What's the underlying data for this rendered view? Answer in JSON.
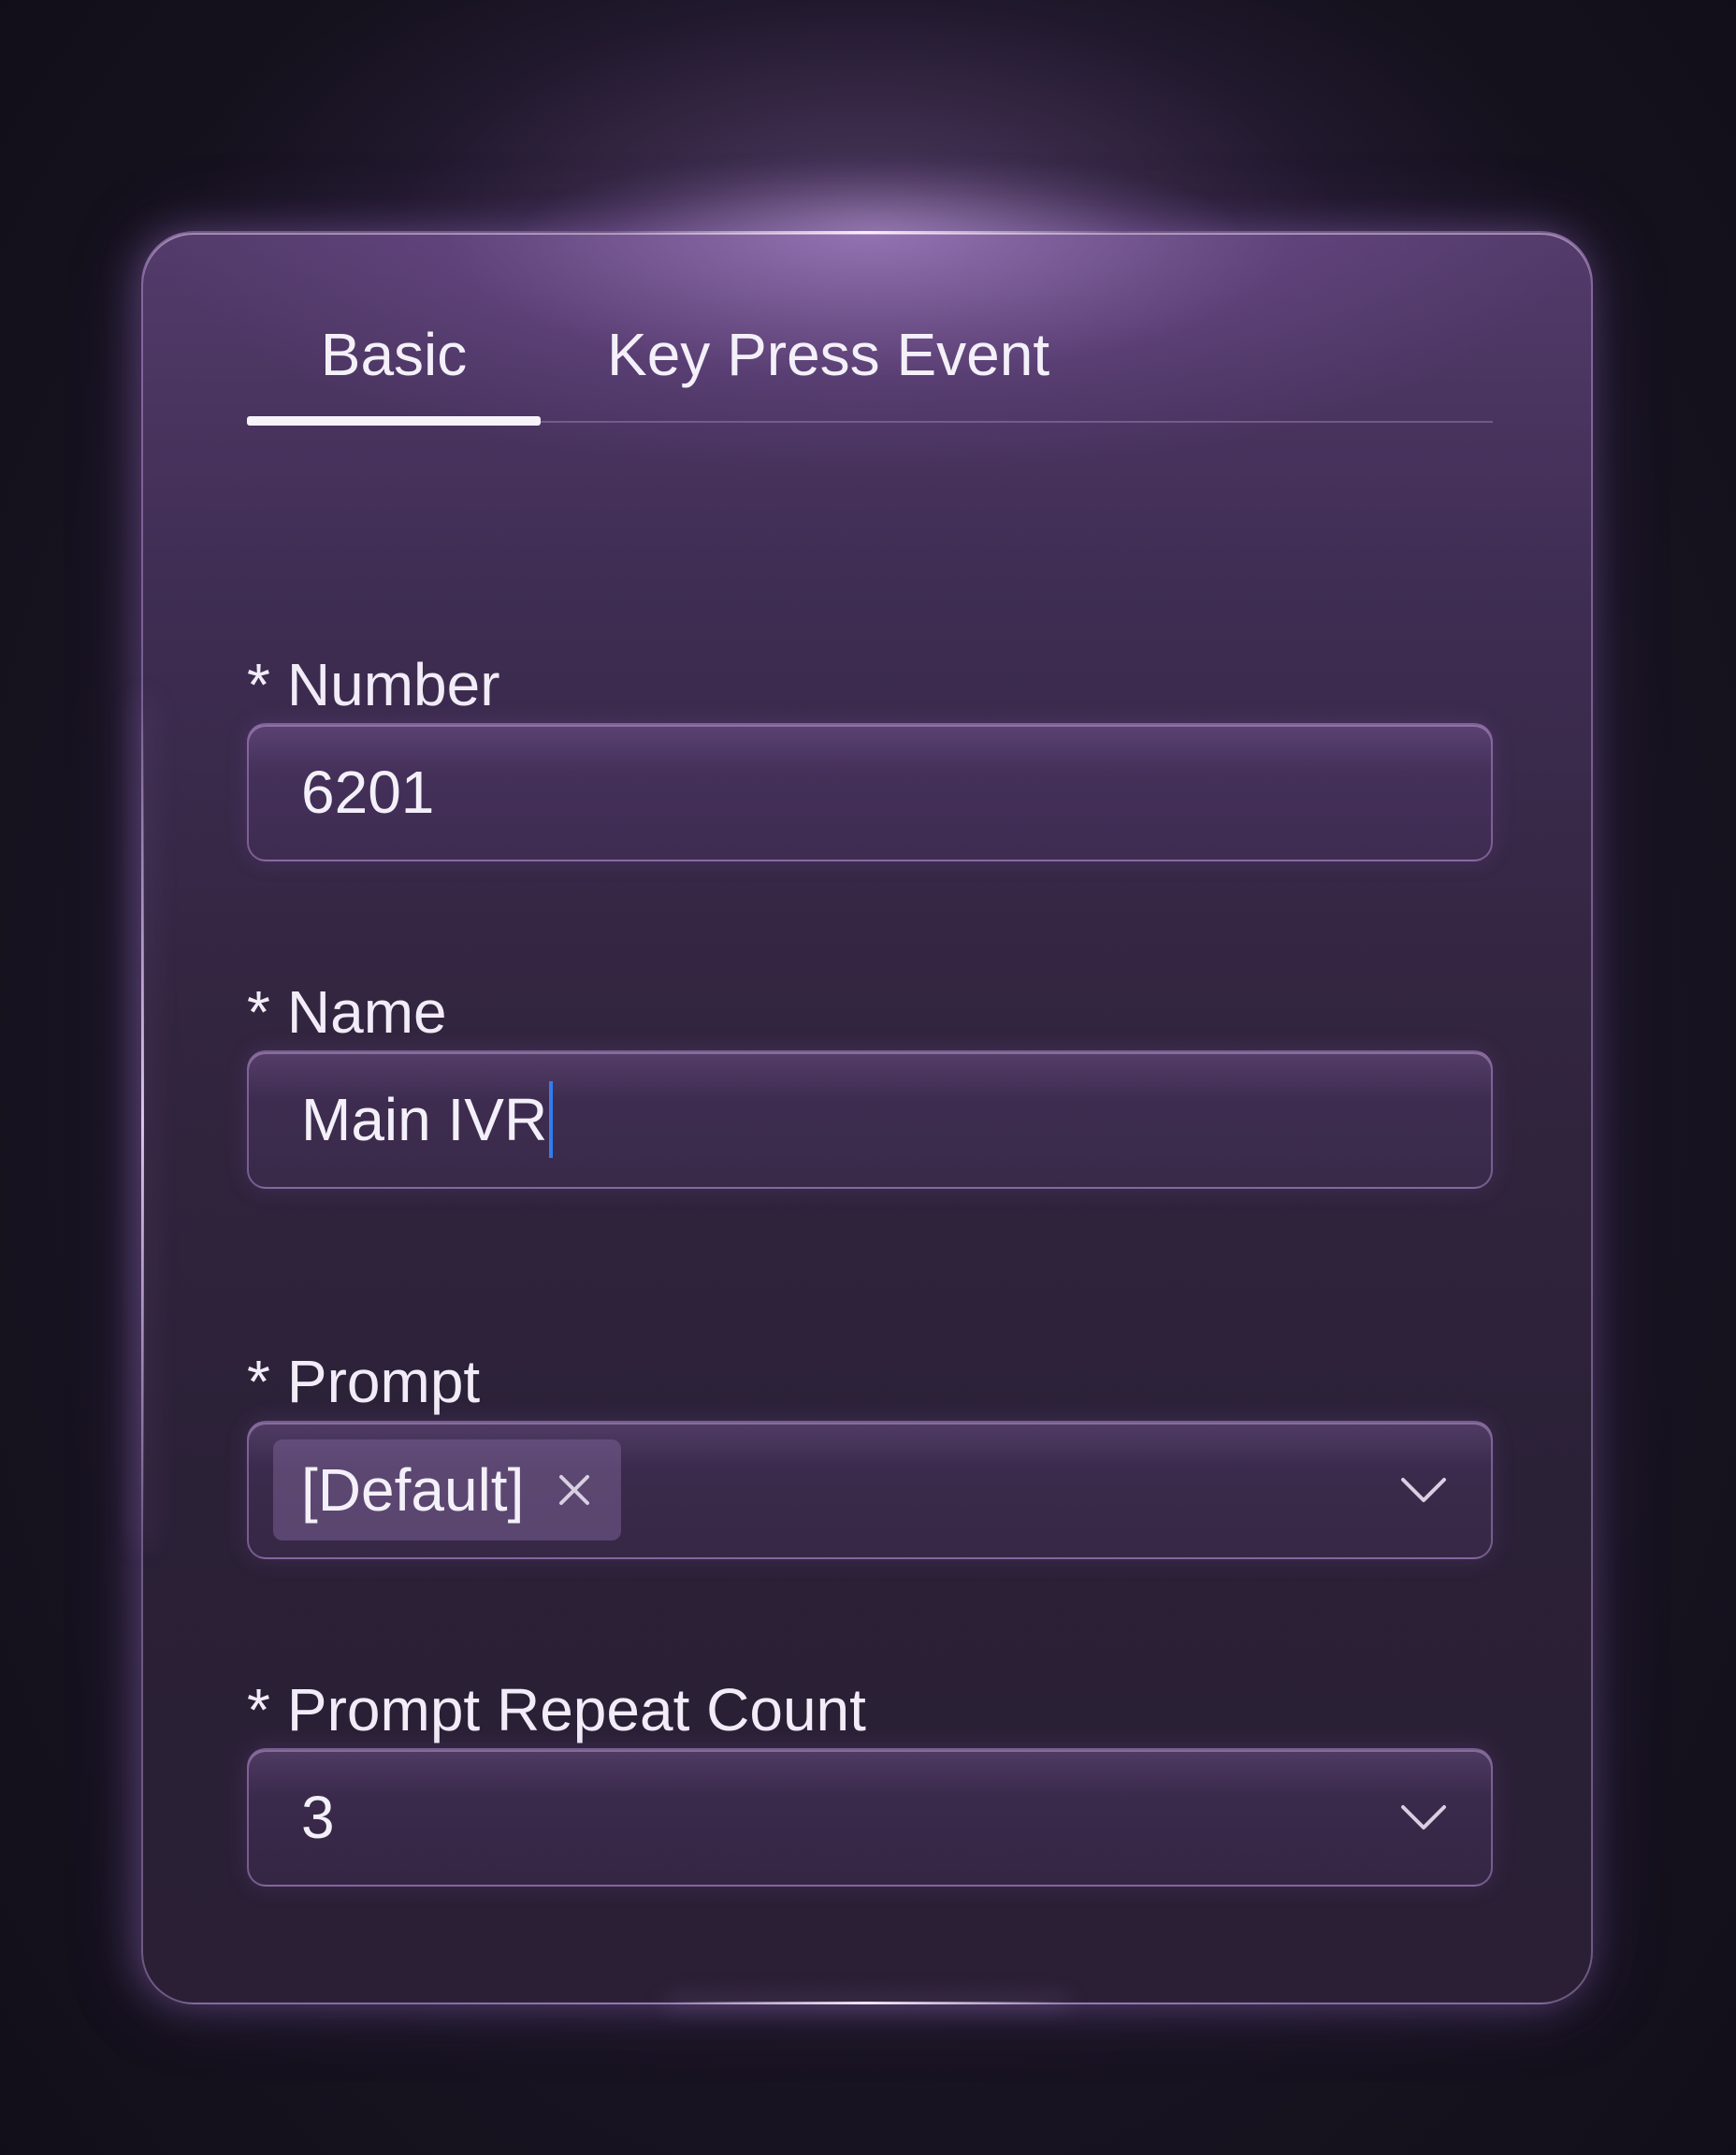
{
  "tabs": [
    {
      "label": "Basic",
      "active": true
    },
    {
      "label": "Key Press Event",
      "active": false
    }
  ],
  "form": {
    "required_marker": "*",
    "number": {
      "label": "Number",
      "value": "6201"
    },
    "name": {
      "label": "Name",
      "value": "Main IVR"
    },
    "prompt": {
      "label": "Prompt",
      "tags": [
        "[Default]"
      ]
    },
    "prompt_repeat_count": {
      "label": "Prompt Repeat Count",
      "value": "3"
    }
  },
  "icons": {
    "tag_remove": "close-icon",
    "dropdown": "chevron-down-icon"
  },
  "colors": {
    "caret": "#2f7df0",
    "active_tab_indicator": "#f7f3fb",
    "card_border": "#c4a0e2"
  }
}
